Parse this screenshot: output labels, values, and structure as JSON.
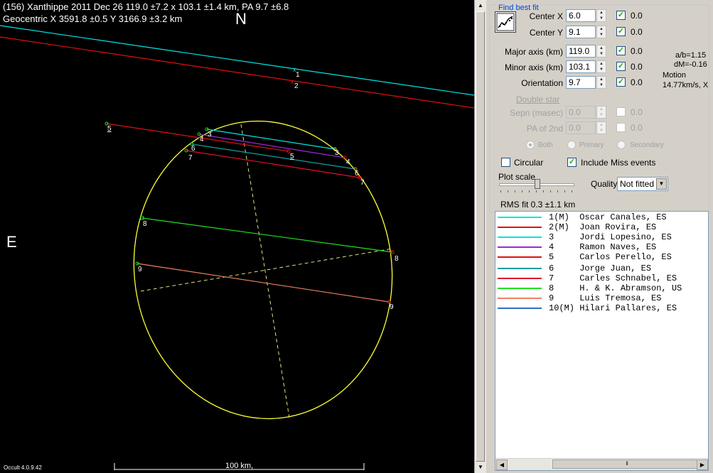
{
  "plot": {
    "title_line1": "(156) Xanthippe  2011 Dec 26  119.0 ±7.2 x 103.1 ±1.4 km, PA 9.7 ±6.8",
    "title_line2": "Geocentric  X  3591.8 ±0.5  Y 3166.9 ±3.2 km",
    "north": "N",
    "east": "E",
    "scale_label": "100 km,",
    "version": "Occult 4.0.9.42",
    "chord_labels": {
      "c1": "1",
      "c2": "2",
      "c3a": "3",
      "c3b": "3",
      "c4a": "4",
      "c4b": "4",
      "c5a": "5",
      "c5b": "5",
      "c6a": "6",
      "c6b": "6",
      "c7a": "7",
      "c7b": "7",
      "c8a": "8",
      "c8b": "8",
      "c9a": "9",
      "c9b": "9"
    },
    "colors": {
      "ellipse": "#ffff33",
      "axis": "#e0e080"
    }
  },
  "panel": {
    "group_title": "Find best fit",
    "best_fit_icon": "chart-fit-icon",
    "center_x": {
      "label": "Center X",
      "value": "6.0",
      "check": "0.0"
    },
    "center_y": {
      "label": "Center Y",
      "value": "9.1",
      "check": "0.0"
    },
    "major_axis": {
      "label": "Major axis (km)",
      "value": "119.0",
      "check": "0.0"
    },
    "minor_axis": {
      "label": "Minor axis (km)",
      "value": "103.1",
      "check": "0.0"
    },
    "orientation": {
      "label": "Orientation",
      "value": "9.7",
      "check": "0.0"
    },
    "ratio": {
      "ab": "a/b=1.15",
      "dm": "dM=-0.16",
      "motion_label": "Motion",
      "motion_value": "14.77km/s, X"
    },
    "double_star": "Double star",
    "sepn": {
      "label": "Sepn (masec)",
      "value": "0.0",
      "check": "0.0"
    },
    "pa2": {
      "label": "PA of 2nd",
      "value": "0.0",
      "check": "0.0"
    },
    "radio": {
      "both": "Both",
      "primary": "Primary",
      "secondary": "Secondary"
    },
    "circular": "Circular",
    "include_miss": "Include Miss events",
    "plot_scale": "Plot scale",
    "quality_label": "Quality",
    "quality_value": "Not fitted",
    "rms": "RMS fit 0.3 ±1.1 km"
  },
  "observers": [
    {
      "text": "1(M)  Oscar Canales, ES",
      "color": "#00e5e5"
    },
    {
      "text": "2(M)  Joan Rovira, ES",
      "color": "#e01010"
    },
    {
      "text": "3     Jordi Lopesino, ES",
      "color": "#00e5e5"
    },
    {
      "text": "4     Ramon Naves, ES",
      "color": "#9a28d8"
    },
    {
      "text": "5     Carlos Perello, ES",
      "color": "#e01010"
    },
    {
      "text": "6     Jorge Juan, ES",
      "color": "#10a0a0"
    },
    {
      "text": "7     Carles Schnabel, ES",
      "color": "#e01030"
    },
    {
      "text": "8     H. & K. Abramson, US",
      "color": "#20e020"
    },
    {
      "text": "9     Luis Tremosa, ES",
      "color": "#f08060"
    },
    {
      "text": "10(M) Hilari Pallares, ES",
      "color": "#3070c0"
    }
  ]
}
